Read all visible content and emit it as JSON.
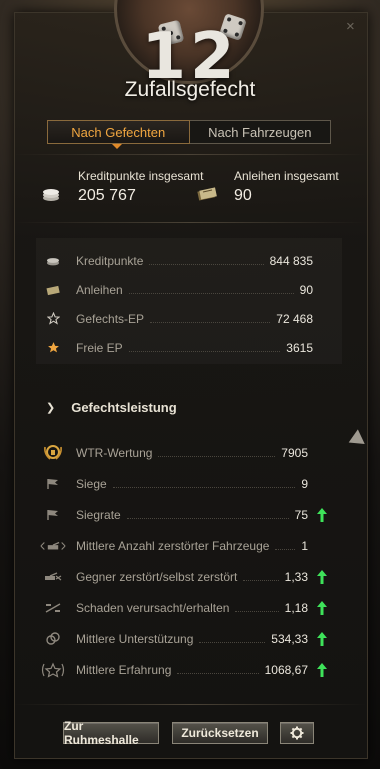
{
  "header": {
    "battle_count": "12",
    "battle_type": "Zufallsgefecht",
    "close_glyph": "×"
  },
  "tabs": [
    {
      "label": "Nach Gefechten",
      "active": true
    },
    {
      "label": "Nach Fahrzeugen",
      "active": false
    }
  ],
  "totals": {
    "credits_label": "Kreditpunkte insgesamt",
    "credits_value": "205 767",
    "bonds_label": "Anleihen insgesamt",
    "bonds_value": "90"
  },
  "earnings": [
    {
      "icon": "credits-icon",
      "label": "Kreditpunkte",
      "value": "844 835"
    },
    {
      "icon": "bonds-icon",
      "label": "Anleihen",
      "value": "90"
    },
    {
      "icon": "battle-xp-star-icon",
      "label": "Gefechts-EP",
      "value": "72 468"
    },
    {
      "icon": "free-xp-star-icon",
      "label": "Freie EP",
      "value": "3615"
    }
  ],
  "performance": {
    "title": "Gefechtsleistung",
    "rows": [
      {
        "icon": "wtr-rating-icon",
        "label": "WTR-Wertung",
        "value": "7905",
        "trend": ""
      },
      {
        "icon": "flag-icon",
        "label": "Siege",
        "value": "9",
        "trend": ""
      },
      {
        "icon": "flag-icon",
        "label": "Siegrate",
        "value": "75",
        "trend": "up"
      },
      {
        "icon": "destroyed-tanks-icon",
        "label": "Mittlere Anzahl zerstörter Fahrzeuge",
        "value": "1",
        "trend": ""
      },
      {
        "icon": "kill-death-ratio-icon",
        "label": "Gegner zerstört/selbst zerstört",
        "value": "1,33",
        "trend": "up"
      },
      {
        "icon": "damage-ratio-icon",
        "label": "Schaden verursacht/erhalten",
        "value": "1,18",
        "trend": "up"
      },
      {
        "icon": "assist-icon",
        "label": "Mittlere Unterstützung",
        "value": "534,33",
        "trend": "up"
      },
      {
        "icon": "experience-icon",
        "label": "Mittlere Erfahrung",
        "value": "1068,67",
        "trend": "up"
      }
    ]
  },
  "footer": {
    "hall_of_fame_label": "Zur Ruhmeshalle",
    "reset_label": "Zurücksetzen",
    "settings_icon": "gear-icon"
  },
  "colors": {
    "accent": "#f0a640",
    "trend_up": "#3ee35a"
  }
}
